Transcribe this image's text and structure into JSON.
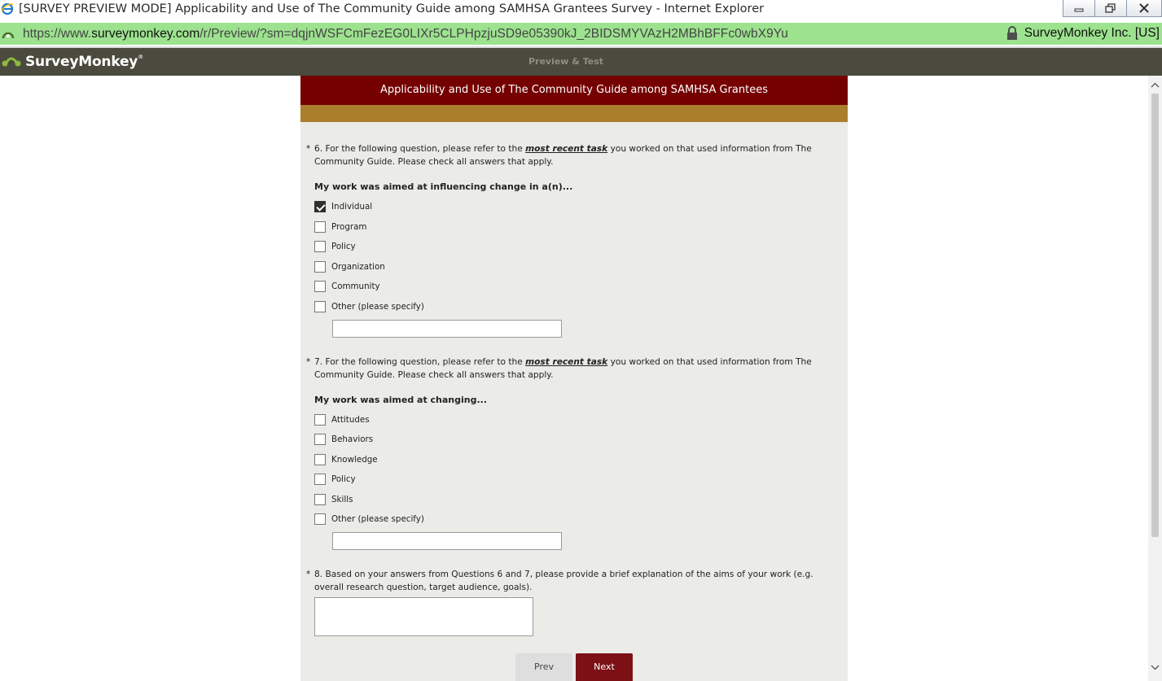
{
  "window": {
    "title": "[SURVEY PREVIEW MODE] Applicability and Use of The Community Guide among SAMHSA Grantees Survey - Internet Explorer"
  },
  "address": {
    "scheme": "https://www.",
    "domain": "surveymonkey.com",
    "path": "/r/Preview/?sm=dqjnWSFCmFezEG0LIXr5CLPHpzjuSD9e05390kJ_2BIDSMYVAzH2MBhBFFc0wbX9Yu",
    "certificate": "SurveyMonkey Inc. [US]"
  },
  "header": {
    "brand": "SurveyMonkey",
    "reg": "®",
    "mode": "Preview & Test"
  },
  "survey": {
    "title": "Applicability and Use of The Community Guide among SAMHSA Grantees",
    "q6": {
      "required": "*",
      "text_a": "6. For the following question, please refer to the ",
      "emphasis": "most recent task",
      "text_b": " you worked on that used information from The",
      "text_c": "Community Guide. Please check all answers that apply.",
      "prompt": "My work was aimed at influencing change in a(n)...",
      "options": [
        "Individual",
        "Program",
        "Policy",
        "Organization",
        "Community",
        "Other (please specify)"
      ]
    },
    "q7": {
      "required": "*",
      "text_a": "7. For the following question, please refer to the ",
      "emphasis": "most recent task",
      "text_b": " you worked on that used information from The",
      "text_c": "Community Guide. Please check all answers that apply.",
      "prompt": "My work was aimed at changing...",
      "options": [
        "Attitudes",
        "Behaviors",
        "Knowledge",
        "Policy",
        "Skills",
        "Other (please specify)"
      ]
    },
    "q8": {
      "required": "*",
      "text_a": "8. Based on your answers from Questions 6 and 7, please provide a brief explanation of the aims of your work (e.g.",
      "text_b": "overall research question, target audience, goals)."
    },
    "prev_label": "Prev",
    "next_label": "Next"
  },
  "colors": {
    "title_bar": "#740000",
    "accent_band": "#a97f2b",
    "header_bg": "#4b4a3e",
    "address_bg": "#9de28f",
    "next_button": "#7c1015"
  }
}
